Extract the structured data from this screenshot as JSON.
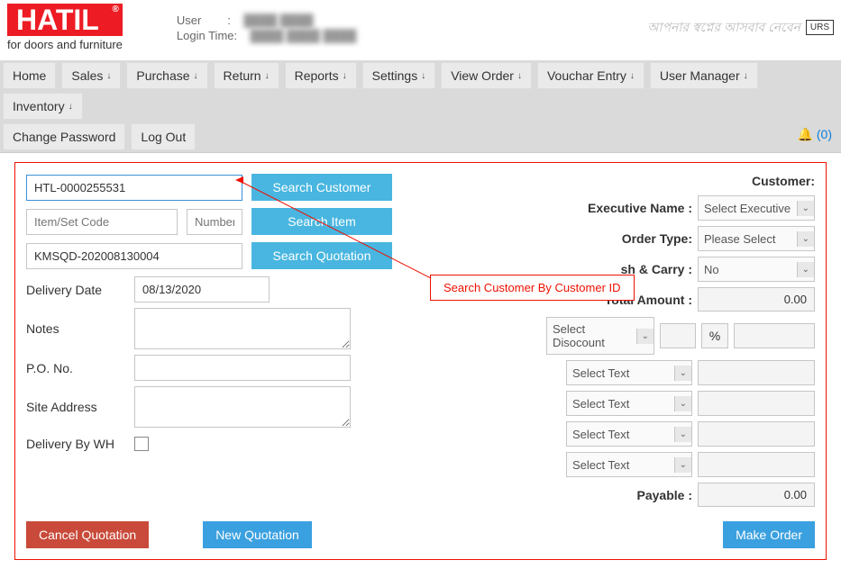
{
  "logo": {
    "brand": "HATIL",
    "reg": "®",
    "tagline": "for doors and furniture"
  },
  "user": {
    "label_user": "User",
    "label_login": "Login Time:",
    "sep": ":"
  },
  "menu": {
    "home": "Home",
    "sales": "Sales",
    "purchase": "Purchase",
    "return": "Return",
    "reports": "Reports",
    "settings": "Settings",
    "view_order": "View Order",
    "vouchar": "Vouchar Entry",
    "user_mgr": "User Manager",
    "inventory": "Inventory",
    "chpwd": "Change Password",
    "logout": "Log Out",
    "arrow": "↓",
    "notif_count": "(0)"
  },
  "search": {
    "cust_id": "HTL-0000255531",
    "btn_cust": "Search Customer",
    "item_code_ph": "Item/Set Code",
    "number_ph": "Number",
    "btn_item": "Search Item",
    "quote": "KMSQD-202008130004",
    "btn_quote": "Search Quotation"
  },
  "callout": {
    "text": "Search Customer By Customer ID"
  },
  "right": {
    "customer_label": "Customer:",
    "exec_label": "Executive Name :",
    "exec_value": "Select Executive",
    "order_type_label": "Order Type:",
    "order_type_value": "Please Select",
    "cash_carry_label": "sh & Carry :",
    "cash_carry_value": "No",
    "total_label": "Total Amount :",
    "total_value": "0.00",
    "discount_value": "Select Disocount",
    "pct": "%",
    "select_text": "Select Text",
    "payable_label": "Payable :",
    "payable_value": "0.00"
  },
  "left": {
    "delivery_date": "Delivery Date",
    "date_value": "08/13/2020",
    "notes": "Notes",
    "po": "P.O. No.",
    "site": "Site Address",
    "wh": "Delivery By WH"
  },
  "buttons": {
    "cancel": "Cancel Quotation",
    "newq": "New Quotation",
    "make": "Make Order"
  },
  "cert": "URS"
}
